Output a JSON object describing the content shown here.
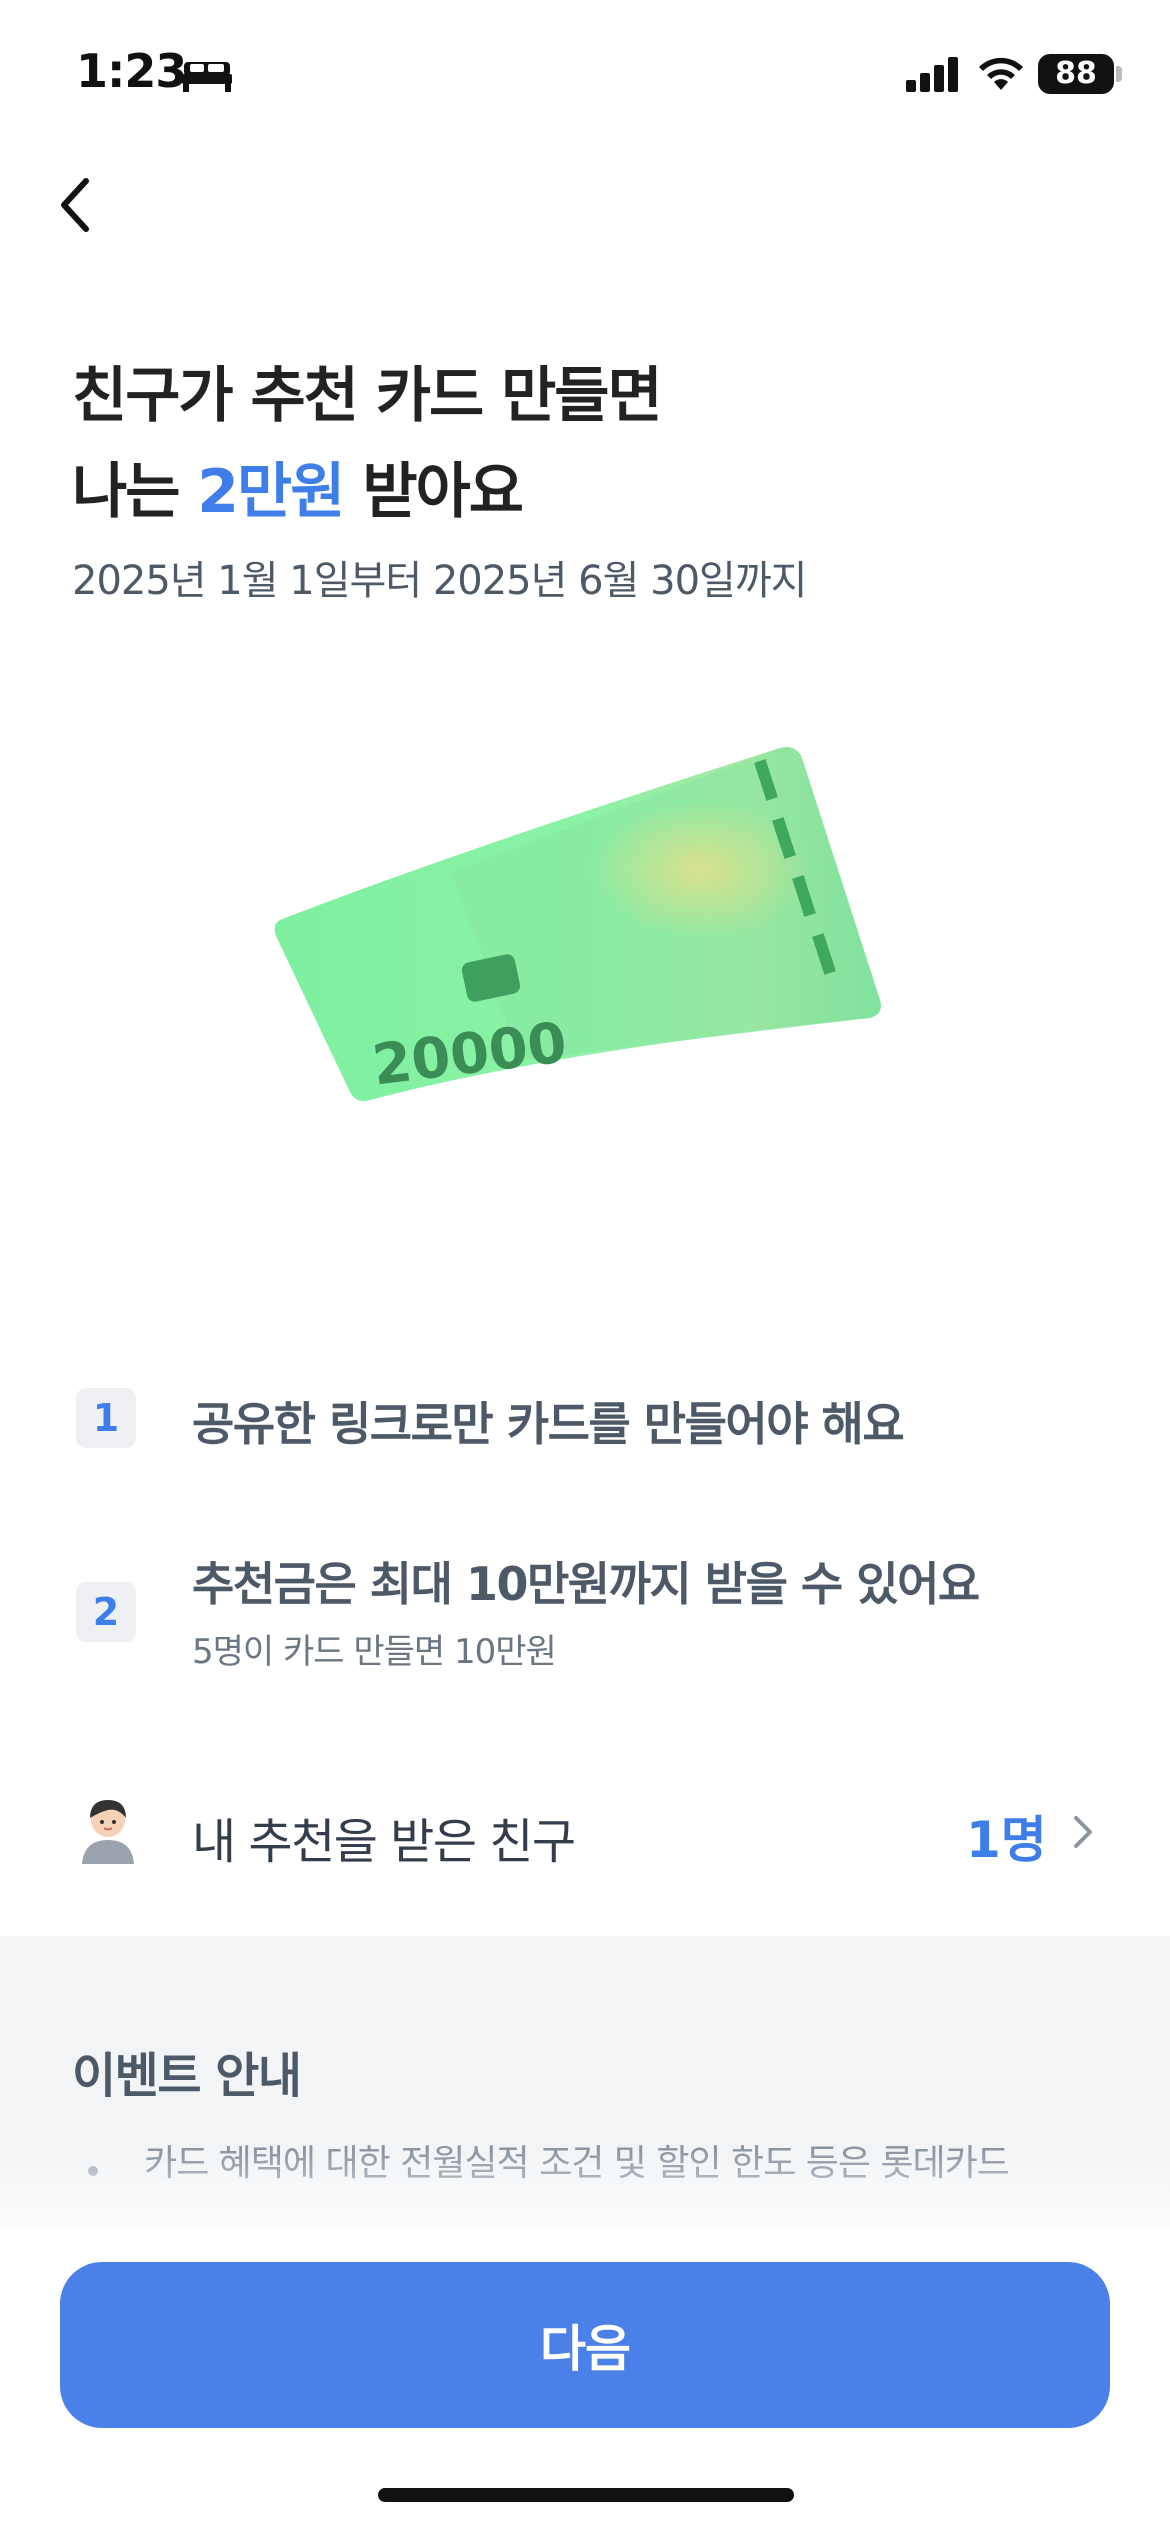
{
  "status_bar": {
    "time": "1:23",
    "battery": "88",
    "icons": [
      "bed-icon",
      "signal-icon",
      "wifi-icon",
      "battery-icon"
    ]
  },
  "nav": {
    "back_icon": "chevron-left-icon"
  },
  "headline": {
    "line1": "친구가 추천 카드 만들면",
    "line2_prefix": "나는 ",
    "line2_accent": "2만원",
    "line2_suffix": " 받아요",
    "accent_color": "#3f7ee8"
  },
  "period": "2025년 1월 1일부터 2025년 6월 30일까지",
  "card": {
    "amount": "20000"
  },
  "rules": [
    {
      "num": "1",
      "title": "공유한 링크로만 카드를 만들어야 해요"
    },
    {
      "num": "2",
      "title": "추천금은 최대 10만원까지 받을 수 있어요",
      "sub": "5명이 카드 만들면 10만원"
    }
  ],
  "friends": {
    "label": "내 추천을 받은 친구",
    "count": "1명"
  },
  "info": {
    "title": "이벤트 안내",
    "text": "카드 혜택에 대한 전월실적 조건 및 할인 한도 등은 롯데카드"
  },
  "next_button": {
    "label": "다음",
    "color": "#4a80e8"
  }
}
